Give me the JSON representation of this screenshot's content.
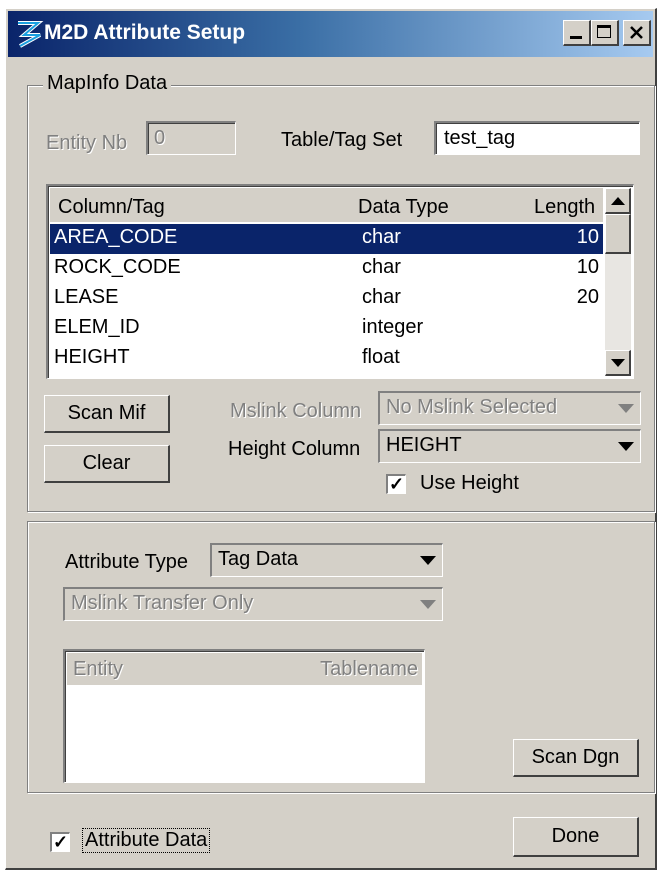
{
  "window": {
    "title": "M2D Attribute Setup",
    "title_buttons": [
      "minimize",
      "maximize",
      "close"
    ]
  },
  "mapinfo": {
    "group_label": "MapInfo Data",
    "entity_nb_label": "Entity Nb",
    "entity_nb_value": "0",
    "table_tag_label": "Table/Tag Set",
    "table_tag_value": "test_tag",
    "columns": [
      "Column/Tag",
      "Data Type",
      "Length"
    ],
    "rows": [
      {
        "tag": "AREA_CODE",
        "type": "char",
        "length": "10",
        "selected": true
      },
      {
        "tag": "ROCK_CODE",
        "type": "char",
        "length": "10",
        "selected": false
      },
      {
        "tag": "LEASE",
        "type": "char",
        "length": "20",
        "selected": false
      },
      {
        "tag": "ELEM_ID",
        "type": "integer",
        "length": "",
        "selected": false
      },
      {
        "tag": "HEIGHT",
        "type": "float",
        "length": "",
        "selected": false
      }
    ],
    "scan_mif_label": "Scan Mif",
    "clear_label": "Clear",
    "mslink_column_label": "Mslink Column",
    "mslink_column_value": "No Mslink Selected",
    "height_column_label": "Height Column",
    "height_column_value": "HEIGHT",
    "use_height_label": "Use Height",
    "use_height_checked": true
  },
  "attribute": {
    "attribute_type_label": "Attribute Type",
    "attribute_type_value": "Tag Data",
    "transfer_value": "Mslink Transfer Only",
    "list_columns": [
      "Entity",
      "Tablename"
    ],
    "scan_dgn_label": "Scan Dgn"
  },
  "footer": {
    "attribute_data_label": "Attribute Data",
    "attribute_data_checked": true,
    "done_label": "Done"
  },
  "colors": {
    "face": "#d4d0c8",
    "title_start": "#0a246a",
    "title_end": "#a6caf0",
    "selection": "#0a246a"
  }
}
